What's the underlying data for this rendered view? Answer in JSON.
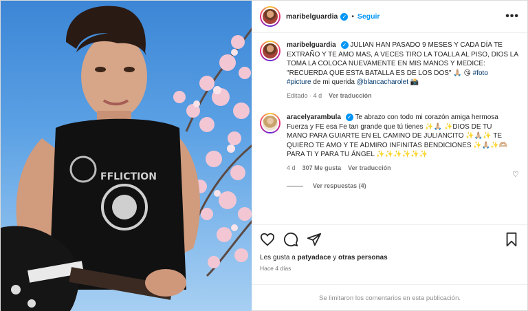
{
  "post": {
    "username": "maribelguardia",
    "follow_label": "Seguir",
    "more_label": "•••",
    "caption": {
      "username": "maribelguardia",
      "text": "JULIAN HAN PASADO 9 MESES Y CADA DÍA TE EXTRAÑO Y TE AMO MAS, A VECES TIRO LA TOALLA AL PISO, DIOS LA TOMA LA COLOCA NUEVAMENTE EN MIS MANOS Y MEDICE:",
      "quote": "\"RECUERDA QUE ESTA BATALLA ES DE LOS DOS\" 🙏🏼 😘",
      "hashtag_foto": "#foto",
      "hashtag_picture": "#picture",
      "photo_credit_prefix": "de mi querida",
      "photo_credit_user": "@blancacharolet",
      "camera_emoji": "📸",
      "edited": "Editado · 4 d",
      "translate": "Ver traducción"
    },
    "comment": {
      "username": "aracelyarambula",
      "text": "Te abrazo con todo mi corazón amiga hermosa Fuerza y FE esa Fe tan grande que tú tienes ✨🙏🏼 ✨DIOS DE TU MANO PARA GUIARTE EN EL CAMINO DE JULIANCITO ✨🙏🏼✨ TE QUIERO TE AMO Y TE ADMIRO INFINITAS BENDICIONES ✨🙏🏼✨🫶🏼 PARA TI Y PARA TU ÁNGEL ✨✨✨✨✨✨",
      "age": "4 d",
      "likes": "307 Me gusta",
      "translate": "Ver traducción",
      "replies": "Ver respuestas (4)"
    },
    "likes_text_prefix": "Les gusta a",
    "likes_user": "patyadace",
    "likes_text_middle": "y",
    "likes_others": "otras personas",
    "time_ago": "Hace 4 días",
    "comments_disabled": "Se limitaron los comentarios en esta publicación."
  },
  "icons": [
    "heart-icon",
    "comment-icon",
    "share-icon",
    "bookmark-icon",
    "verified-badge-icon",
    "more-options-icon"
  ],
  "colors": {
    "link": "#0095f6",
    "tag": "#00376b",
    "muted": "#737373",
    "border": "#efefef"
  }
}
